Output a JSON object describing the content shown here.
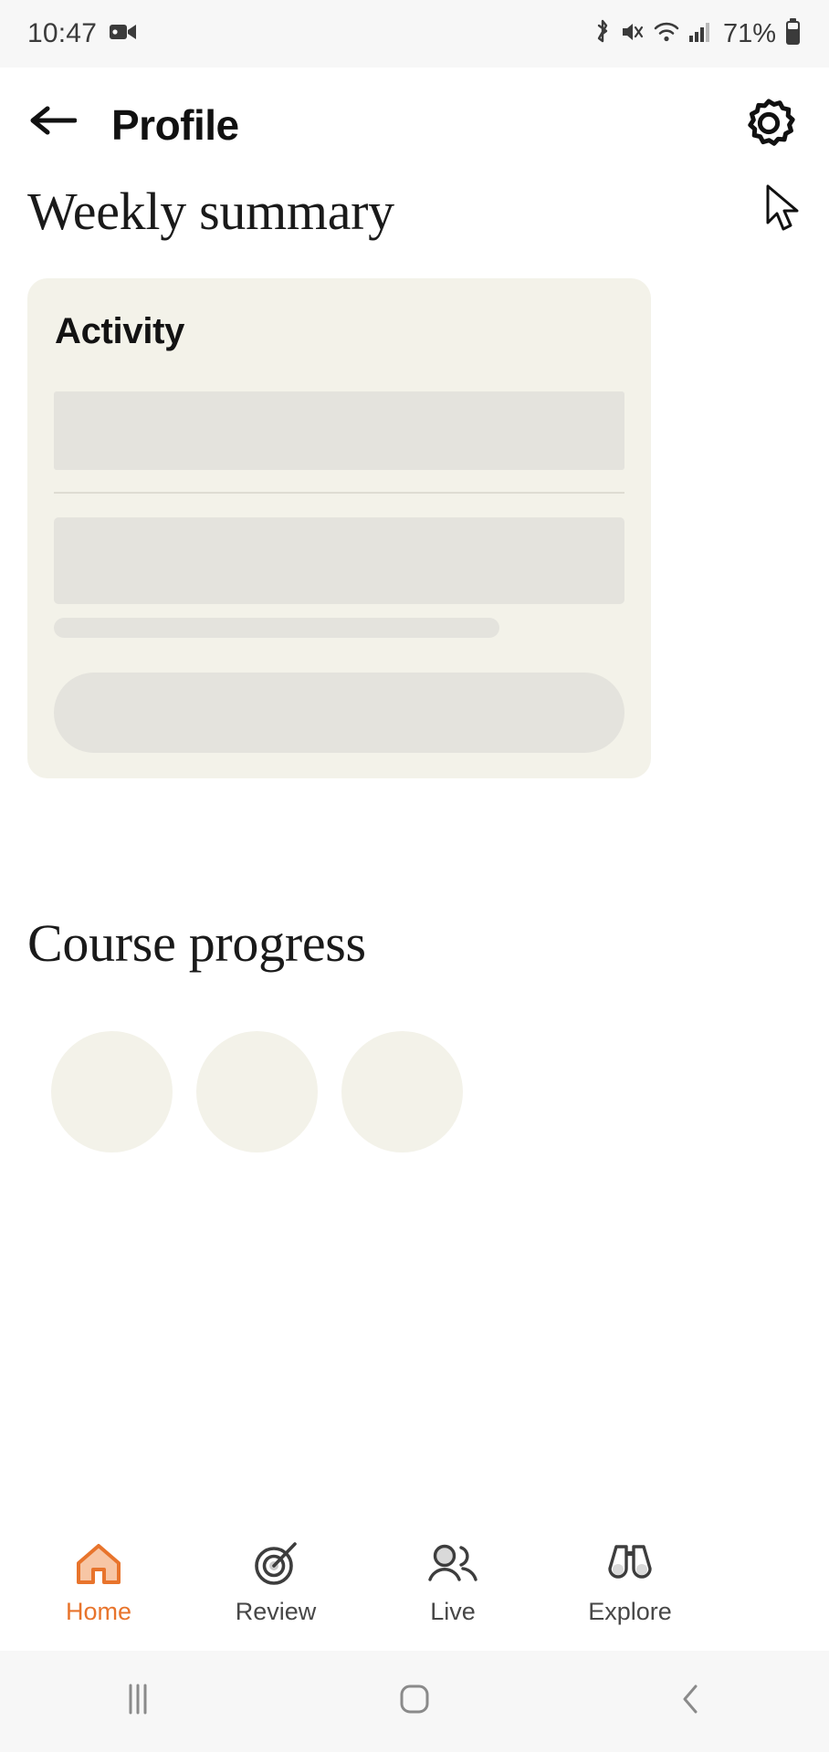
{
  "status_bar": {
    "time": "10:47",
    "battery_percent": "71%",
    "icons": [
      "video-camera-icon",
      "bluetooth-icon",
      "mute-icon",
      "wifi-icon",
      "cellular-signal-icon",
      "battery-icon"
    ]
  },
  "app_bar": {
    "back_icon": "back-arrow-icon",
    "title": "Profile",
    "settings_icon": "gear-icon",
    "cursor_icon": "mouse-cursor"
  },
  "main": {
    "weekly_heading": "Weekly summary",
    "activity_card": {
      "title": "Activity",
      "loading": true,
      "placeholders": [
        "block",
        "divider",
        "block",
        "line",
        "pill"
      ]
    },
    "course_heading": "Course progress",
    "course_circles": 3
  },
  "tab_bar": {
    "active": "Home",
    "items": [
      {
        "label": "Home",
        "icon": "home-icon"
      },
      {
        "label": "Review",
        "icon": "target-icon"
      },
      {
        "label": "Live",
        "icon": "people-icon"
      },
      {
        "label": "Explore",
        "icon": "binoculars-icon"
      }
    ]
  },
  "system_nav": {
    "recents_icon": "recents-icon",
    "home_icon": "home-square-icon",
    "back_icon": "back-chevron-icon"
  },
  "colors": {
    "accent": "#e8742c",
    "card_bg": "#f3f2e9",
    "skeleton": "#e4e3dd",
    "text": "#111111"
  }
}
